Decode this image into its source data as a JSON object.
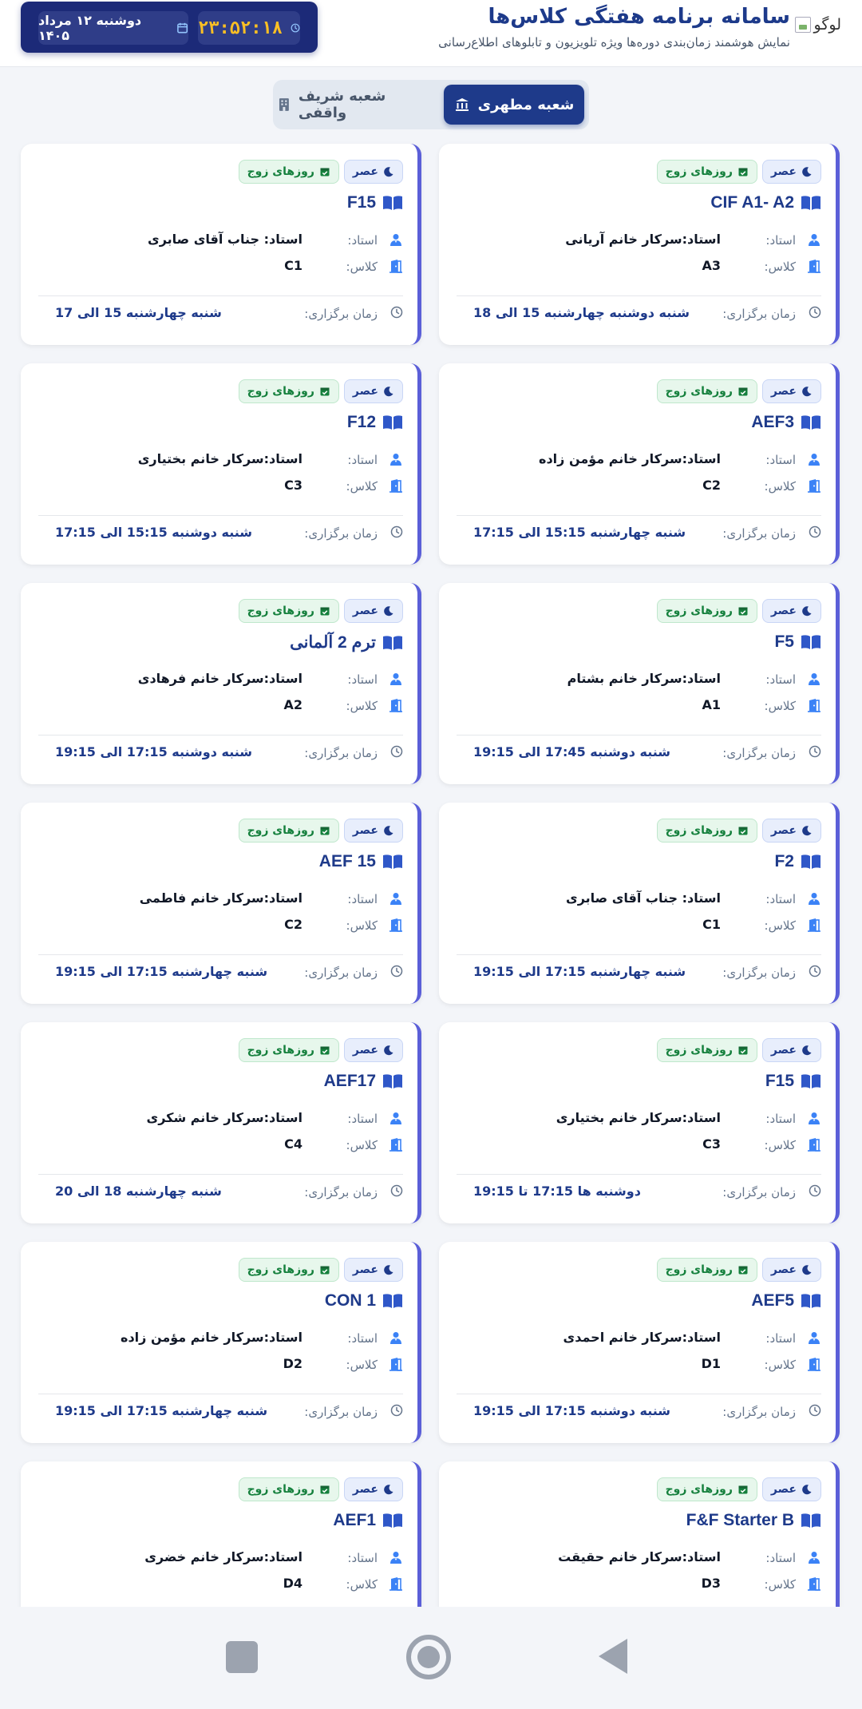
{
  "header": {
    "logo_alt": "لوگو",
    "title": "سامانه برنامه هفتگی کلاس‌ها",
    "subtitle": "نمایش هوشمند زمان‌بندی دوره‌ها ویژه تلویزیون و تابلوهای اطلاع‌رسانی",
    "clock": "۲۳:۵۲:۱۸",
    "date": "دوشنبه ۱۲ مرداد ۱۴۰۵"
  },
  "tabs": [
    {
      "label": "شعبه مطهری",
      "active": true
    },
    {
      "label": "شعبه شریف واقفی",
      "active": false
    }
  ],
  "labels": {
    "teacher": "استاد:",
    "room": "کلاس:",
    "when": "زمان برگزاری:"
  },
  "cards": [
    {
      "time_chip": "عصر",
      "days_chip": "روزهای زوج",
      "course": "CIF A1- A2",
      "teacher": "استاد:سرکار خانم آریانی",
      "room": "A3",
      "schedule": "شنبه دوشنبه چهارشنبه 15 الی 18"
    },
    {
      "time_chip": "عصر",
      "days_chip": "روزهای زوج",
      "course": "F15",
      "teacher": "استاد: جناب آقای صابری",
      "room": "C1",
      "schedule": "شنبه چهارشنبه 15 الی 17"
    },
    {
      "time_chip": "عصر",
      "days_chip": "روزهای زوج",
      "course": "AEF3",
      "teacher": "استاد:سرکار خانم مؤمن زاده",
      "room": "C2",
      "schedule": "شنبه چهارشنبه 15:15 الی 17:15"
    },
    {
      "time_chip": "عصر",
      "days_chip": "روزهای زوج",
      "course": "F12",
      "teacher": "استاد:سرکار خانم بختیاری",
      "room": "C3",
      "schedule": "شنبه دوشنبه 15:15 الی 17:15"
    },
    {
      "time_chip": "عصر",
      "days_chip": "روزهای زوج",
      "course": "F5",
      "teacher": "استاد:سرکار خانم بشتام",
      "room": "A1",
      "schedule": "شنبه دوشنبه 17:45 الی 19:15"
    },
    {
      "time_chip": "عصر",
      "days_chip": "روزهای زوج",
      "course": "ترم 2 آلمانی",
      "teacher": "استاد:سرکار خانم فرهادی",
      "room": "A2",
      "schedule": "شنبه دوشنبه 17:15 الی 19:15"
    },
    {
      "time_chip": "عصر",
      "days_chip": "روزهای زوج",
      "course": "F2",
      "teacher": "استاد: جناب آقای صابری",
      "room": "C1",
      "schedule": "شنبه چهارشنبه 17:15 الی 19:15"
    },
    {
      "time_chip": "عصر",
      "days_chip": "روزهای زوج",
      "course": "AEF 15",
      "teacher": "استاد:سرکار خانم فاطمی",
      "room": "C2",
      "schedule": "شنبه چهارشنبه 17:15 الی 19:15"
    },
    {
      "time_chip": "عصر",
      "days_chip": "روزهای زوج",
      "course": "F15",
      "teacher": "استاد:سرکار خانم بختیاری",
      "room": "C3",
      "schedule": "دوشنبه ها 17:15 تا 19:15"
    },
    {
      "time_chip": "عصر",
      "days_chip": "روزهای زوج",
      "course": "AEF17",
      "teacher": "استاد:سرکار خانم شکری",
      "room": "C4",
      "schedule": "شنبه چهارشنبه 18 الی 20"
    },
    {
      "time_chip": "عصر",
      "days_chip": "روزهای زوج",
      "course": "AEF5",
      "teacher": "استاد:سرکار خانم احمدی",
      "room": "D1",
      "schedule": "شنبه دوشنبه 17:15 الی 19:15"
    },
    {
      "time_chip": "عصر",
      "days_chip": "روزهای زوج",
      "course": "CON 1",
      "teacher": "استاد:سرکار خانم مؤمن زاده",
      "room": "D2",
      "schedule": "شنبه چهارشنبه 17:15 الی 19:15"
    },
    {
      "time_chip": "عصر",
      "days_chip": "روزهای زوج",
      "course": "F&F Starter B",
      "teacher": "استاد:سرکار خانم حقیقت",
      "room": "D3",
      "schedule": ""
    },
    {
      "time_chip": "عصر",
      "days_chip": "روزهای زوج",
      "course": "AEF1",
      "teacher": "استاد:سرکار خانم خضری",
      "room": "D4",
      "schedule": ""
    }
  ],
  "colors": {
    "brand": "#1e3a8a",
    "accent_border": "#5b5fd8",
    "clock_text": "#fbbf24",
    "days_chip": "#15803d"
  },
  "icons": {
    "time_chip": "moon-icon",
    "days_chip": "calendar-check-icon",
    "course": "book-icon",
    "teacher": "user-icon",
    "room": "door-icon",
    "when": "clock-icon"
  }
}
